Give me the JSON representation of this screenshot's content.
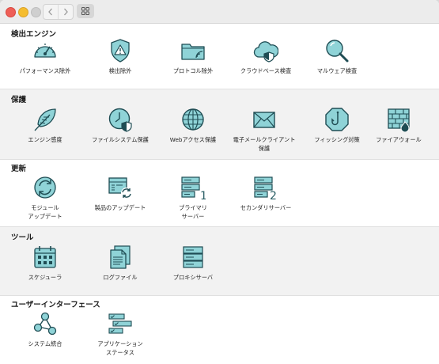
{
  "colors": {
    "icon_fill": "#8fd3d7",
    "icon_stroke": "#1f4d54",
    "accent_dark": "#2b5f66"
  },
  "sections": [
    {
      "title": "検出エンジン",
      "items": [
        {
          "label": "パフォーマンス除外",
          "icon": "speedometer-icon"
        },
        {
          "label": "検出除外",
          "icon": "shield-warning-icon"
        },
        {
          "label": "プロトコル除外",
          "icon": "folder-signal-icon"
        },
        {
          "label": "クラウドベース検査",
          "icon": "cloud-shield-icon"
        },
        {
          "label": "マルウェア検査",
          "icon": "magnifier-icon"
        }
      ]
    },
    {
      "title": "保護",
      "items": [
        {
          "label": "エンジン感度",
          "icon": "feather-icon"
        },
        {
          "label": "ファイルシステム保護",
          "icon": "clock-shield-icon"
        },
        {
          "label": "Webアクセス保護",
          "icon": "globe-icon"
        },
        {
          "label": "電子メールクライアント\n保護",
          "icon": "envelope-icon"
        },
        {
          "label": "フィッシング対策",
          "icon": "hook-octagon-icon"
        },
        {
          "label": "ファイアウォール",
          "icon": "brick-wall-fire-icon"
        }
      ]
    },
    {
      "title": "更新",
      "items": [
        {
          "label": "モジュール\nアップデート",
          "icon": "refresh-circle-icon"
        },
        {
          "label": "製品のアップデート",
          "icon": "window-refresh-icon"
        },
        {
          "label": "プライマリ\nサーバー",
          "icon": "server-1-icon"
        },
        {
          "label": "セカンダリサーバー",
          "icon": "server-2-icon"
        }
      ]
    },
    {
      "title": "ツール",
      "items": [
        {
          "label": "スケジューラ",
          "icon": "calendar-icon"
        },
        {
          "label": "ログファイル",
          "icon": "log-files-icon"
        },
        {
          "label": "プロキシサーバ",
          "icon": "server-stack-icon"
        }
      ]
    },
    {
      "title": "ユーザーインターフェース",
      "items": [
        {
          "label": "システム統合",
          "icon": "nodes-icon"
        },
        {
          "label": "アプリケーション\nステータス",
          "icon": "status-bars-icon"
        }
      ]
    }
  ]
}
